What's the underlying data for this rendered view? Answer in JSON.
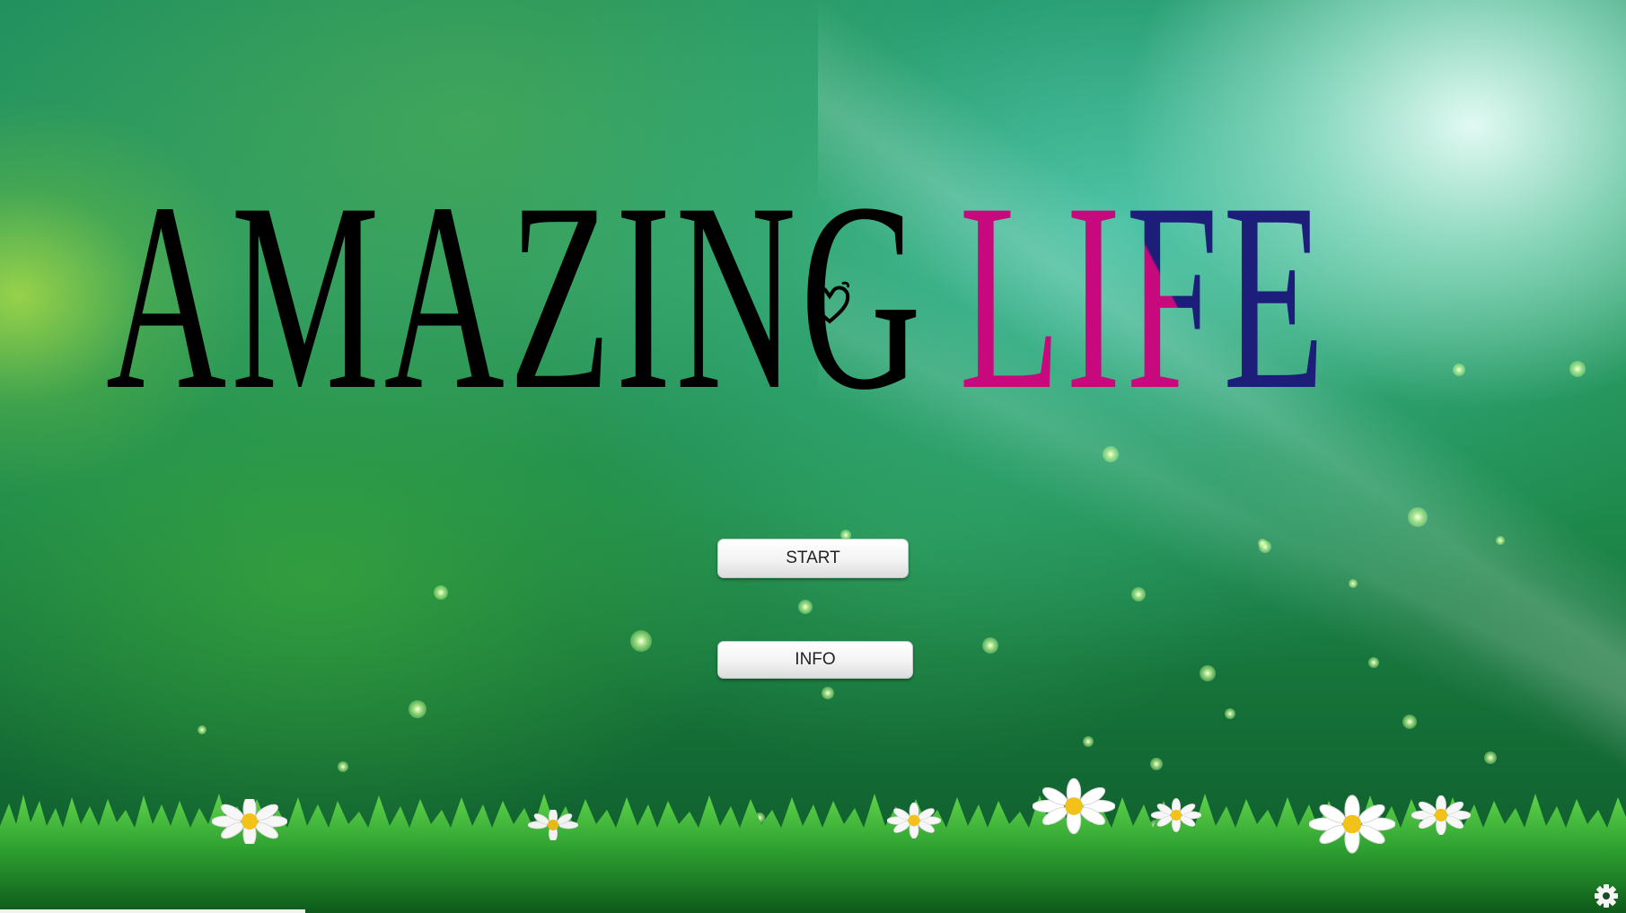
{
  "game": {
    "title_word1": "AMAZING",
    "title_word2": "LIFE"
  },
  "menu": {
    "start_label": "START",
    "info_label": "INFO"
  },
  "icons": {
    "title_decoration": "heart-icon",
    "settings": "gear-icon"
  },
  "colors": {
    "title_primary": "#000000",
    "title_pink": "#c7097d",
    "title_navy": "#1c1e7a",
    "button_bg": "#f3f3f3"
  }
}
